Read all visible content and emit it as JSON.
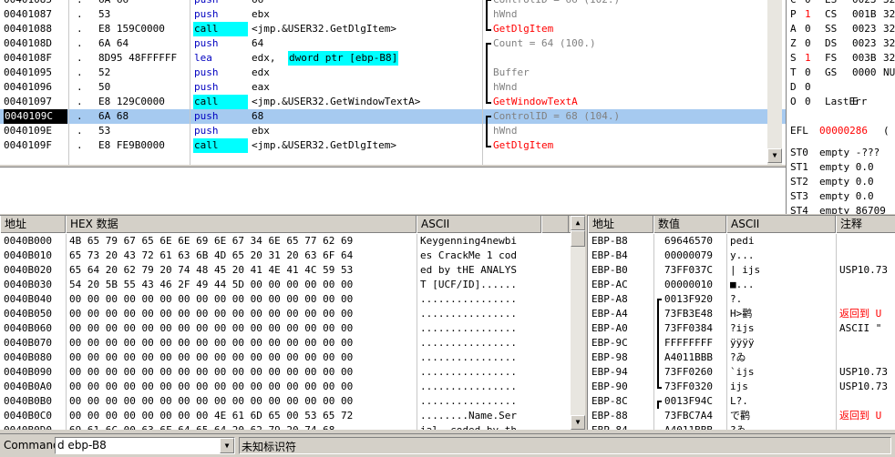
{
  "disasm": [
    {
      "addr": "00401085",
      "hex": "6A 66",
      "mn": "push",
      "op": "66",
      "cm": "ControlID = 66 (102.)",
      "br": "top"
    },
    {
      "addr": "00401087",
      "hex": "53",
      "mn": "push",
      "op": "ebx",
      "cm": "hWnd",
      "br": "mid"
    },
    {
      "addr": "00401088",
      "hex": "E8 159C0000",
      "mn": "call",
      "op": "<jmp.&USER32.GetDlgItem>",
      "cm": "GetDlgItem",
      "br": "bot",
      "call": true
    },
    {
      "addr": "0040108D",
      "hex": "6A 64",
      "mn": "push",
      "op": "64",
      "cm": "Count = 64 (100.)",
      "br": "top"
    },
    {
      "addr": "0040108F",
      "hex": "8D95 48FFFFFF",
      "mn": "lea",
      "op_pre": "edx, ",
      "op_hl": "dword ptr [ebp-B8]",
      "cm": "",
      "br": "mid"
    },
    {
      "addr": "00401095",
      "hex": "52",
      "mn": "push",
      "op": "edx",
      "cm": "Buffer",
      "br": "mid"
    },
    {
      "addr": "00401096",
      "hex": "50",
      "mn": "push",
      "op": "eax",
      "cm": "hWnd",
      "br": "mid"
    },
    {
      "addr": "00401097",
      "hex": "E8 129C0000",
      "mn": "call",
      "op": "<jmp.&USER32.GetWindowTextA>",
      "cm": "GetWindowTextA",
      "br": "bot",
      "call": true
    },
    {
      "addr": "0040109C",
      "hex": "6A 68",
      "mn": "push",
      "op": "68",
      "cm": "ControlID = 68 (104.)",
      "br": "top",
      "current": true
    },
    {
      "addr": "0040109E",
      "hex": "53",
      "mn": "push",
      "op": "ebx",
      "cm": "hWnd",
      "br": "mid"
    },
    {
      "addr": "0040109F",
      "hex": "E8 FE9B0000",
      "mn": "call",
      "op": "<jmp.&USER32.GetDlgItem>",
      "cm": "GetDlgItem",
      "br": "bot",
      "call": true
    }
  ],
  "registers": [
    {
      "flag": "C",
      "bit": "0",
      "seg": "ES",
      "val": "0023",
      "bits": "32"
    },
    {
      "flag": "P",
      "bit": "1",
      "seg": "CS",
      "val": "001B",
      "bits": "32",
      "red": true
    },
    {
      "flag": "A",
      "bit": "0",
      "seg": "SS",
      "val": "0023",
      "bits": "32"
    },
    {
      "flag": "Z",
      "bit": "0",
      "seg": "DS",
      "val": "0023",
      "bits": "32"
    },
    {
      "flag": "S",
      "bit": "1",
      "seg": "FS",
      "val": "003B",
      "bits": "32",
      "red": true
    },
    {
      "flag": "T",
      "bit": "0",
      "seg": "GS",
      "val": "0000",
      "bits": "NU"
    },
    {
      "flag": "D",
      "bit": "0",
      "seg": "",
      "val": "",
      "bits": ""
    },
    {
      "flag": "O",
      "bit": "0",
      "seg": "LastErr",
      "val": "E",
      "bits": ""
    }
  ],
  "efl": {
    "label": "EFL",
    "value": "00000286",
    "rest": "("
  },
  "fpu": [
    {
      "name": "ST0",
      "text": "empty -???"
    },
    {
      "name": "ST1",
      "text": "empty 0.0"
    },
    {
      "name": "ST2",
      "text": "empty 0.0"
    },
    {
      "name": "ST3",
      "text": "empty 0.0"
    },
    {
      "name": "ST4",
      "text": "empty 86709"
    }
  ],
  "dump": {
    "headers": {
      "addr": "地址",
      "hex": "HEX 数据",
      "ascii": "ASCII"
    },
    "rows": [
      {
        "addr": "0040B000",
        "hex": "4B 65 79 67 65 6E 6E 69 6E 67 34 6E 65 77 62 69",
        "ascii": "Keygenning4newbi"
      },
      {
        "addr": "0040B010",
        "hex": "65 73 20 43 72 61 63 6B 4D 65 20 31 20 63 6F 64",
        "ascii": "es CrackMe 1 cod"
      },
      {
        "addr": "0040B020",
        "hex": "65 64 20 62 79 20 74 48 45 20 41 4E 41 4C 59 53",
        "ascii": "ed by tHE ANALYS"
      },
      {
        "addr": "0040B030",
        "hex": "54 20 5B 55 43 46 2F 49 44 5D 00 00 00 00 00 00",
        "ascii": "T [UCF/ID]......"
      },
      {
        "addr": "0040B040",
        "hex": "00 00 00 00 00 00 00 00 00 00 00 00 00 00 00 00",
        "ascii": "................"
      },
      {
        "addr": "0040B050",
        "hex": "00 00 00 00 00 00 00 00 00 00 00 00 00 00 00 00",
        "ascii": "................"
      },
      {
        "addr": "0040B060",
        "hex": "00 00 00 00 00 00 00 00 00 00 00 00 00 00 00 00",
        "ascii": "................"
      },
      {
        "addr": "0040B070",
        "hex": "00 00 00 00 00 00 00 00 00 00 00 00 00 00 00 00",
        "ascii": "................"
      },
      {
        "addr": "0040B080",
        "hex": "00 00 00 00 00 00 00 00 00 00 00 00 00 00 00 00",
        "ascii": "................"
      },
      {
        "addr": "0040B090",
        "hex": "00 00 00 00 00 00 00 00 00 00 00 00 00 00 00 00",
        "ascii": "................"
      },
      {
        "addr": "0040B0A0",
        "hex": "00 00 00 00 00 00 00 00 00 00 00 00 00 00 00 00",
        "ascii": "................"
      },
      {
        "addr": "0040B0B0",
        "hex": "00 00 00 00 00 00 00 00 00 00 00 00 00 00 00 00",
        "ascii": "................"
      },
      {
        "addr": "0040B0C0",
        "hex": "00 00 00 00 00 00 00 00 4E 61 6D 65 00 53 65 72",
        "ascii": "........Name.Ser"
      },
      {
        "addr": "0040B0D0",
        "hex": "69 61 6C 00 63 6F 64 65 64 20 62 79 20 74 68",
        "ascii": "ial..coded by th"
      }
    ]
  },
  "stack": {
    "headers": {
      "addr": "地址",
      "val": "数值",
      "ascii": "ASCII",
      "comment": "注释"
    },
    "rows": [
      {
        "addr": "EBP-B8",
        "val": "69646570",
        "ascii": "pedi",
        "comment": ""
      },
      {
        "addr": "EBP-B4",
        "val": "00000079",
        "ascii": "y...",
        "comment": ""
      },
      {
        "addr": "EBP-B0",
        "val": "73FF037C",
        "ascii": "| ijs",
        "comment": "USP10.73"
      },
      {
        "addr": "EBP-AC",
        "val": "00000010",
        "ascii": "■...",
        "comment": ""
      },
      {
        "addr": "EBP-A8",
        "val": "0013F920",
        "ascii": " ?.",
        "comment": "",
        "br": "top"
      },
      {
        "addr": "EBP-A4",
        "val": "73FB3E48",
        "ascii": "H>鹳",
        "comment": "返回到 U",
        "red": true
      },
      {
        "addr": "EBP-A0",
        "val": "73FF0384",
        "ascii": "?ijs",
        "comment": "ASCII \""
      },
      {
        "addr": "EBP-9C",
        "val": "FFFFFFFF",
        "ascii": "ÿÿÿÿ",
        "comment": ""
      },
      {
        "addr": "EBP-98",
        "val": "A4011BBB",
        "ascii": "?ゐ",
        "comment": ""
      },
      {
        "addr": "EBP-94",
        "val": "73FF0260",
        "ascii": "`ijs",
        "comment": "USP10.73"
      },
      {
        "addr": "EBP-90",
        "val": "73FF0320",
        "ascii": " ijs",
        "comment": "USP10.73",
        "br": "bot"
      },
      {
        "addr": "EBP-8C",
        "val": "0013F94C",
        "ascii": "L?.",
        "comment": "",
        "br": "top"
      },
      {
        "addr": "EBP-88",
        "val": "73FBC7A4",
        "ascii": "で鹳",
        "comment": "返回到 U",
        "red": true
      },
      {
        "addr": "EBP-84",
        "val": "A4011BBB",
        "ascii": "?ゐ",
        "comment": ""
      }
    ]
  },
  "command": {
    "label": "Command",
    "value": "d ebp-B8",
    "status": "未知标识符"
  }
}
